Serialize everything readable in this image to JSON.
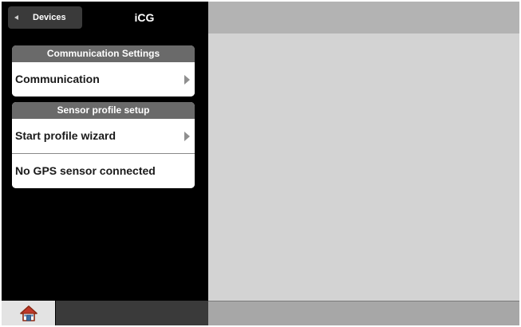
{
  "header": {
    "back_label": "Devices",
    "title": "iCG"
  },
  "groups": [
    {
      "title": "Communication Settings",
      "rows": [
        {
          "label": "Communication",
          "has_chevron": true
        }
      ]
    },
    {
      "title": "Sensor profile setup",
      "rows": [
        {
          "label": "Start profile wizard",
          "has_chevron": true
        },
        {
          "label": "No GPS sensor connected",
          "has_chevron": false
        }
      ]
    }
  ],
  "footer": {
    "home_icon": "home-icon"
  }
}
